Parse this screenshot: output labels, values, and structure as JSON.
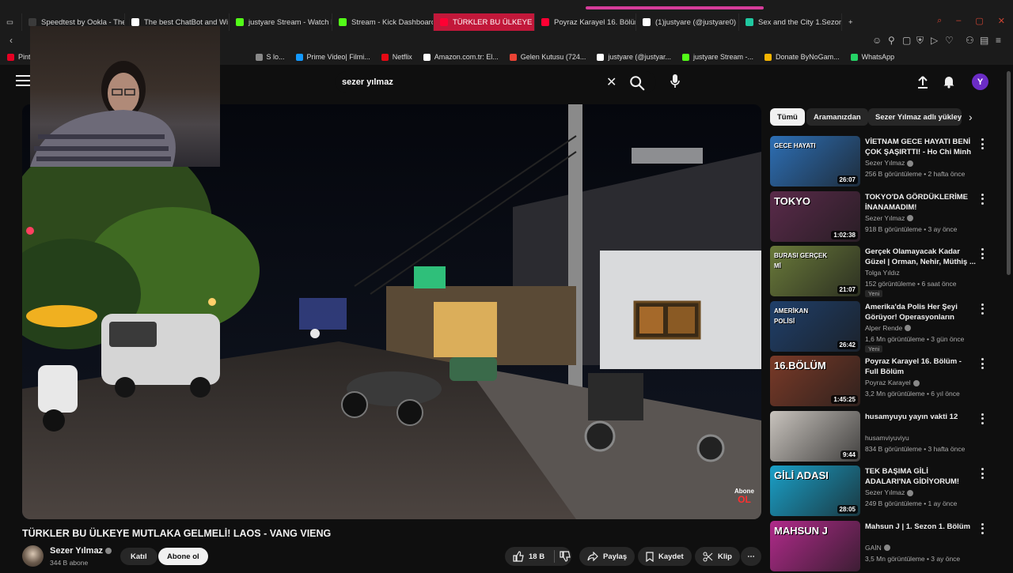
{
  "browser": {
    "tabs": [
      {
        "label": "Speedtest by Ookla - The",
        "color": "#3b3b3b"
      },
      {
        "label": "The best ChatBot and Wi",
        "color": "#ffffff"
      },
      {
        "label": "justyare Stream - Watch L",
        "color": "#53fc18"
      },
      {
        "label": "Stream - Kick Dashboard",
        "color": "#53fc18"
      },
      {
        "label": "TÜRKLER BU ÜLKEYE",
        "color": "#ff0033"
      },
      {
        "label": "Poyraz Karayel 16. Bölüm",
        "color": "#ff0033"
      },
      {
        "label": "(1)justyare (@justyare0) |",
        "color": "#ffffff"
      },
      {
        "label": "Sex and the City 1.Sezon",
        "color": "#20c8a0"
      }
    ],
    "new_tab_label": "+",
    "bookmarks": [
      {
        "label": "Pint",
        "color": "#e60023"
      },
      {
        "label": "S lo...",
        "color": "#888888"
      },
      {
        "label": "Prime Video| Filmi...",
        "color": "#1399ff"
      },
      {
        "label": "Netflix",
        "color": "#e50914"
      },
      {
        "label": "Amazon.com.tr: El...",
        "color": "#ffffff"
      },
      {
        "label": "Gelen Kutusu (724...",
        "color": "#ea4335"
      },
      {
        "label": "justyare (@justyar...",
        "color": "#ffffff"
      },
      {
        "label": "justyare Stream -...",
        "color": "#53fc18"
      },
      {
        "label": "Donate ByNoGam...",
        "color": "#f4b400"
      },
      {
        "label": "WhatsApp",
        "color": "#25d366"
      }
    ]
  },
  "header": {
    "search_value": "sezer yılmaz",
    "avatar_letter": "Y"
  },
  "video": {
    "title": "TÜRKLER BU ÜLKEYE MUTLAKA GELMELİ! LAOS - VANG VIENG",
    "channel": "Sezer Yılmaz",
    "subscribers": "344 B abone",
    "join_label": "Katıl",
    "subscribe_label": "Abone ol",
    "likes": "18 B",
    "share_label": "Paylaş",
    "save_label": "Kaydet",
    "clip_label": "Klip",
    "watermark_top": "Abone",
    "watermark_bottom": "OL"
  },
  "chips": [
    "Tümü",
    "Aramanızdan",
    "Sezer Yılmaz adlı yükley"
  ],
  "recommendations": [
    {
      "title": "VİETNAM GECE HAYATI BENİ ÇOK ŞAŞIRTTI! - Ho Chi Minh",
      "channel": "Sezer Yılmaz",
      "verified": true,
      "meta": "256 B görüntüleme • 2 hafta önce",
      "duration": "26:07",
      "badge": "",
      "thumb_text": "GECE HAYATI",
      "thumb_bg": "#2d6fb5"
    },
    {
      "title": "TOKYO'DA GÖRDÜKLERİME İNANAMADIM!",
      "channel": "Sezer Yılmaz",
      "verified": true,
      "meta": "918 B görüntüleme • 3 ay önce",
      "duration": "1:02:38",
      "badge": "",
      "thumb_text": "TOKYO",
      "thumb_bg": "#5a2a4a"
    },
    {
      "title": "Gerçek Olamayacak Kadar Güzel | Orman, Nehir, Müthiş ...",
      "channel": "Tolga Yıldız",
      "verified": false,
      "meta": "152 görüntüleme • 6 saat önce",
      "duration": "21:07",
      "badge": "Yeni",
      "thumb_text": "BURASI GERÇEK Mİ",
      "thumb_bg": "#6a7a3a"
    },
    {
      "title": "Amerika'da Polis Her Şeyi Görüyor! Operasyonların Perde...",
      "channel": "Alper Rende",
      "verified": true,
      "meta": "1,6 Mn görüntüleme • 3 gün önce",
      "duration": "26:42",
      "badge": "Yeni",
      "thumb_text": "AMERİKAN POLİSİ",
      "thumb_bg": "#1f3f6a"
    },
    {
      "title": "Poyraz Karayel 16. Bölüm - Full Bölüm",
      "channel": "Poyraz Karayel",
      "verified": true,
      "meta": "3,2 Mn görüntüleme • 6 yıl önce",
      "duration": "1:45:25",
      "badge": "",
      "thumb_text": "16.BÖLÜM",
      "thumb_bg": "#7a3a28"
    },
    {
      "title": "husamyuyu yayın vakti 12",
      "channel": "husamviyuviyu",
      "verified": false,
      "meta": "834 B görüntüleme • 3 hafta önce",
      "duration": "9:44",
      "badge": "",
      "thumb_text": "",
      "thumb_bg": "#c8c3bd"
    },
    {
      "title": "TEK BAŞIMA GİLİ ADALARI'NA GİDİYORUM!",
      "channel": "Sezer Yılmaz",
      "verified": true,
      "meta": "249 B görüntüleme • 1 ay önce",
      "duration": "28:05",
      "badge": "",
      "thumb_text": "GİLİ ADASI",
      "thumb_bg": "#1aa0c8"
    },
    {
      "title": "Mahsun J | 1. Sezon 1. Bölüm",
      "channel": "GAİN",
      "verified": true,
      "meta": "3,5 Mn görüntüleme • 3 ay önce",
      "duration": "",
      "badge": "",
      "thumb_text": "MAHSUN J",
      "thumb_bg": "#b02a8a"
    }
  ]
}
